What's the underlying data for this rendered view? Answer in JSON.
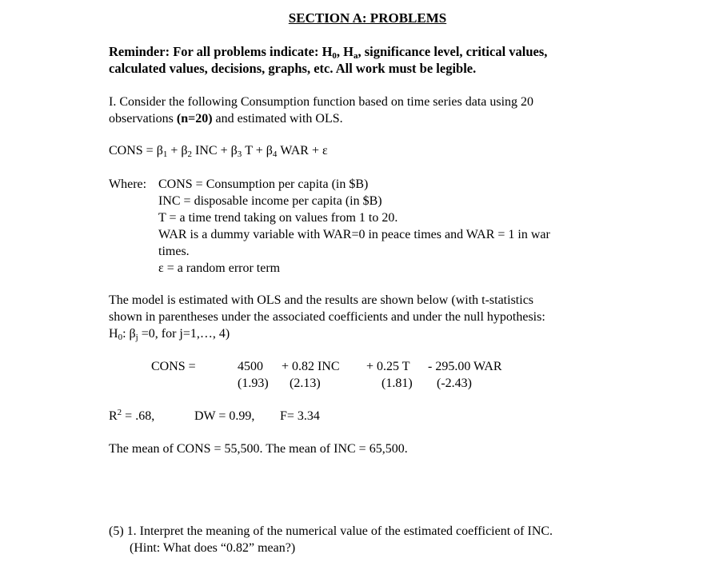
{
  "section_title": "SECTION A: PROBLEMS",
  "reminder": {
    "line1_a": "Reminder:  For all problems indicate: H",
    "h0_sub": "0",
    "line1_b": ", H",
    "ha_sub": "a",
    "line1_c": ", significance level, critical values,",
    "line2": "calculated values, decisions, graphs, etc.  All work must be legible."
  },
  "problem_intro": {
    "line1": "I.  Consider the following Consumption function based on time series data using 20",
    "line2_a": "observations ",
    "line2_bold": "(n=20)",
    "line2_b": " and estimated with OLS."
  },
  "model_equation": {
    "lhs": "CONS = ",
    "b1": "β",
    "b1_sub": "1",
    "plus1": " + ",
    "b2": "β",
    "b2_sub": "2",
    "inc": " INC  +  ",
    "b3": "β",
    "b3_sub": "3",
    "t": " T  +  ",
    "b4": "β",
    "b4_sub": "4",
    "war": " WAR + ε"
  },
  "definitions": {
    "where_label": "Where:  ",
    "items": [
      "CONS = Consumption per capita (in $B)",
      "INC = disposable income per capita (in $B)",
      "T = a time trend taking on values from 1 to 20.",
      "WAR is a dummy variable with WAR=0 in peace times and WAR = 1 in war",
      "times.",
      "ε = a random error term"
    ]
  },
  "model_text": {
    "line1": "The model is estimated with OLS and the results are shown below (with t-statistics",
    "line2": "shown in parentheses under the associated coefficients and under the null hypothesis:",
    "line3_a": "H",
    "line3_h_sub": "0",
    "line3_b": ": β",
    "line3_j_sub": "j",
    "line3_c": " =0, for j=1,…, 4)"
  },
  "estimates": {
    "lhs": "CONS =",
    "terms": [
      {
        "coef": "4500",
        "tstat": "(1.93)"
      },
      {
        "coef": "+  0.82 INC",
        "tstat": "(2.13)"
      },
      {
        "coef": "+  0.25 T",
        "tstat": "(1.81)"
      },
      {
        "coef": "-  295.00 WAR",
        "tstat": "(-2.43)"
      }
    ]
  },
  "fit_stats": {
    "r2_label": "R",
    "r2_sup": "2",
    "r2_value": " =  .68,",
    "dw": "DW = 0.99,",
    "f": "F= 3.34"
  },
  "means": "The mean of CONS = 55,500.  The mean of INC = 65,500.",
  "questions": [
    {
      "line1": "(5) 1.  Interpret the meaning of the numerical value of the estimated coefficient of INC.",
      "line2": "(Hint:  What does “0.82” mean?)"
    }
  ]
}
